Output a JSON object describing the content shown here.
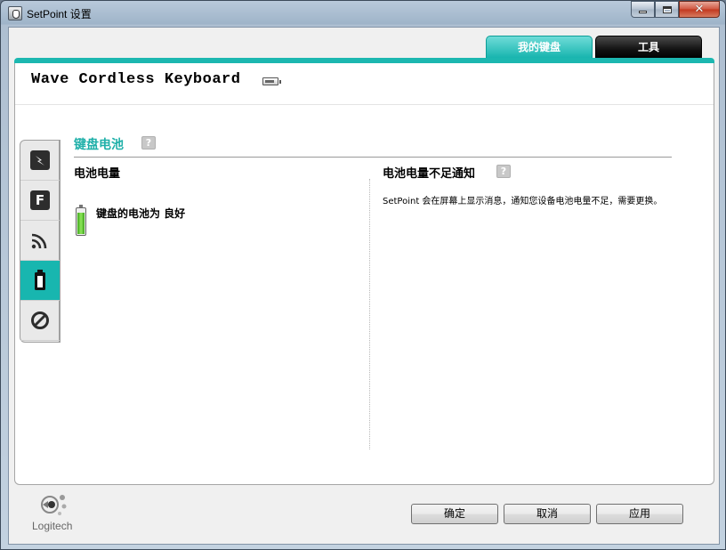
{
  "window": {
    "title": "SetPoint 设置",
    "icon": "mouse-app-icon",
    "controls": {
      "minimize": "minimize-icon",
      "maximize": "maximize-icon",
      "close": "close-icon"
    }
  },
  "tabs": [
    {
      "label": "我的键盘",
      "active": true
    },
    {
      "label": "工具",
      "active": false
    }
  ],
  "device": {
    "name": "Wave Cordless Keyboard",
    "battery_icon": "battery-icon"
  },
  "side_tabs": [
    {
      "name": "side-tab-keyboard-function",
      "icon": "lightning-icon"
    },
    {
      "name": "side-tab-f-keys",
      "icon": "f-key-icon",
      "glyph": "F"
    },
    {
      "name": "side-tab-wireless",
      "icon": "wireless-icon"
    },
    {
      "name": "side-tab-battery",
      "icon": "battery-icon",
      "active": true
    },
    {
      "name": "side-tab-disable",
      "icon": "no-sign-icon"
    }
  ],
  "section": {
    "title": "键盘电池",
    "help": "?"
  },
  "left_col": {
    "heading": "电池电量",
    "status": "键盘的电池为 良好",
    "battery_level": 0.8
  },
  "right_col": {
    "heading": "电池电量不足通知",
    "help": "?",
    "description": "SetPoint 会在屏幕上显示消息，通知您设备电池电量不足，需要更换。"
  },
  "footer": {
    "logo_text": "Logitech",
    "buttons": {
      "ok": "确定",
      "cancel": "取消",
      "apply": "应用"
    }
  },
  "colors": {
    "accent": "#1cb7b0",
    "tools_tab": "#000000"
  }
}
